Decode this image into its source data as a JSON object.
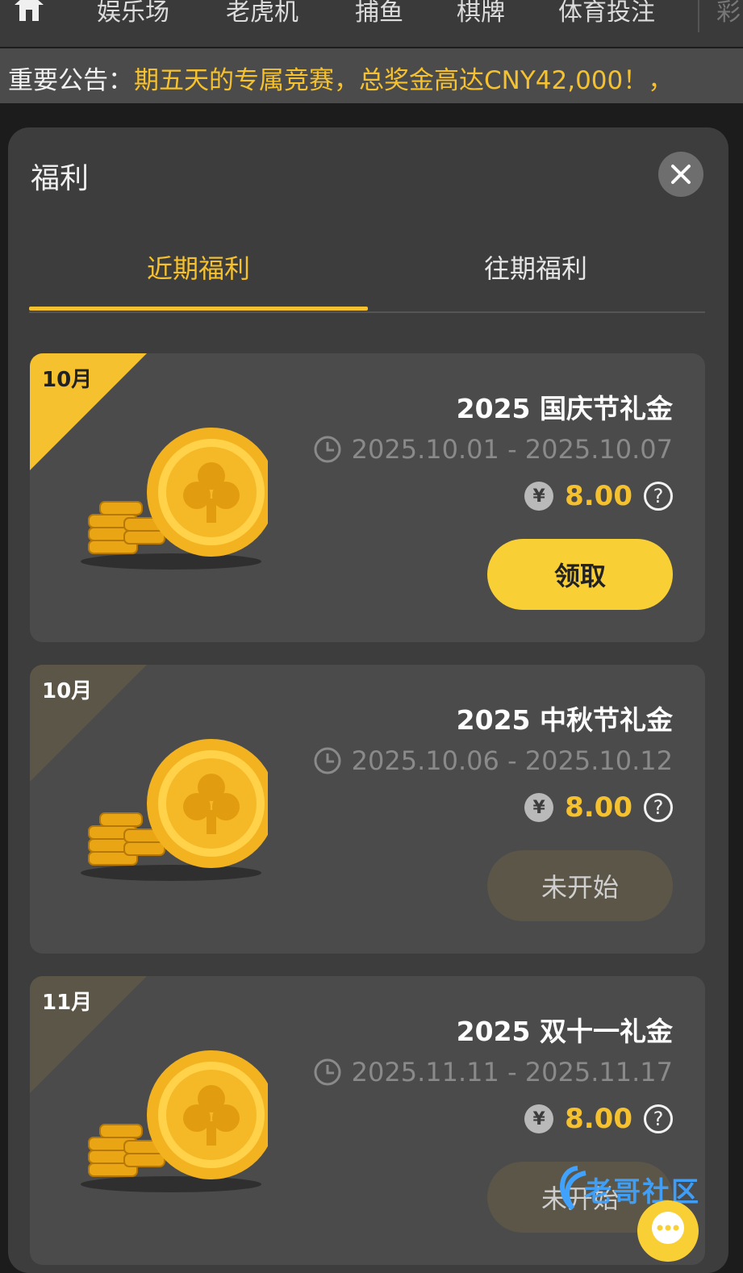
{
  "nav": {
    "items": [
      "娱乐场",
      "老虎机",
      "捕鱼",
      "棋牌",
      "体育投注"
    ],
    "cut_item": "彩"
  },
  "announcement": {
    "label": "重要公告：",
    "text": "期五天的专属竞赛，总奖金高达CNY42,000！，"
  },
  "panel": {
    "title": "福利",
    "tabs": [
      {
        "label": "近期福利",
        "active": true
      },
      {
        "label": "往期福利",
        "active": false
      }
    ]
  },
  "cards": [
    {
      "month": "10月",
      "title": "2025 国庆节礼金",
      "date_range": "2025.10.01 - 2025.10.07",
      "currency_icon": "¥",
      "amount": "8.00",
      "button": "领取",
      "button_state": "claimable"
    },
    {
      "month": "10月",
      "title": "2025 中秋节礼金",
      "date_range": "2025.10.06 - 2025.10.12",
      "currency_icon": "¥",
      "amount": "8.00",
      "button": "未开始",
      "button_state": "not-started"
    },
    {
      "month": "11月",
      "title": "2025 双十一礼金",
      "date_range": "2025.11.11 - 2025.11.17",
      "currency_icon": "¥",
      "amount": "8.00",
      "button": "未开始",
      "button_state": "not-started"
    }
  ],
  "watermark": {
    "text": "老哥社区"
  },
  "colors": {
    "accent": "#f5c12e",
    "ribbon_active": "#f5c12e",
    "ribbon_inactive": "#5b5647"
  }
}
